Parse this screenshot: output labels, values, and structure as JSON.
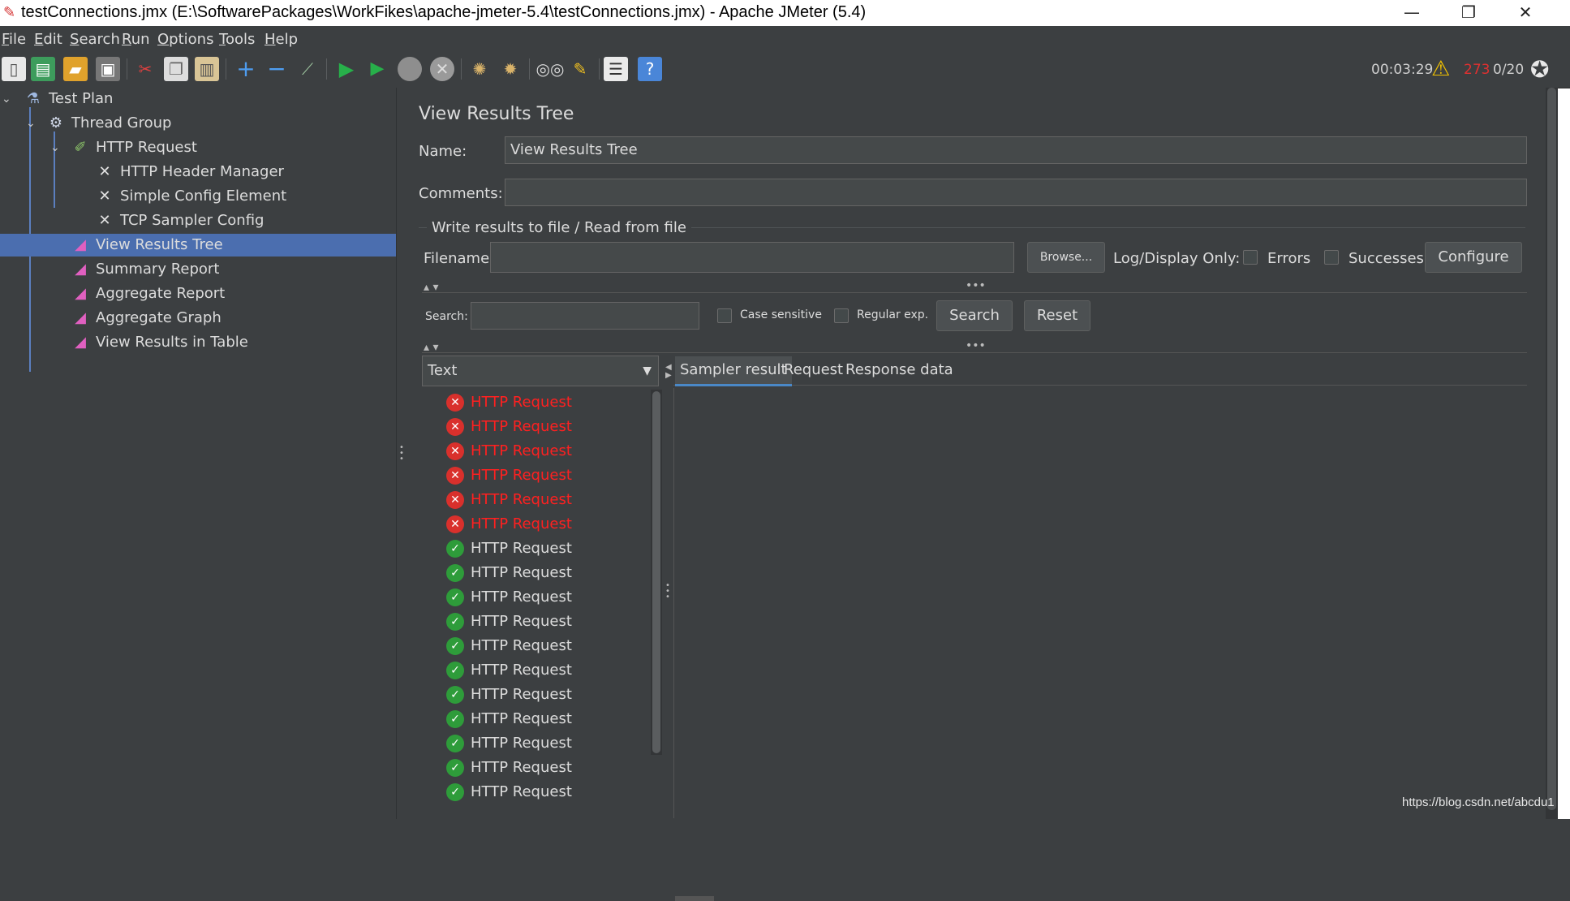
{
  "window": {
    "title": "testConnections.jmx (E:\\SoftwarePackages\\WorkFikes\\apache-jmeter-5.4\\testConnections.jmx) - Apache JMeter (5.4)",
    "minimize_icon": "minimize-icon",
    "restore_icon": "restore-icon",
    "close_icon": "close-icon"
  },
  "menu": [
    "File",
    "Edit",
    "Search",
    "Run",
    "Options",
    "Tools",
    "Help"
  ],
  "toolbar": {
    "icons": [
      "new-icon",
      "templates-icon",
      "open-icon",
      "save-icon",
      "cut-icon",
      "copy-icon",
      "paste-icon",
      "expand-icon",
      "collapse-icon",
      "toggle-icon",
      "start-icon",
      "start-no-pause-icon",
      "stop-icon",
      "shutdown-icon",
      "clear-icon",
      "clear-all-icon",
      "search-icon",
      "reset-search-icon",
      "function-helper-icon",
      "help-icon"
    ],
    "timer": "00:03:29",
    "warnings": "273",
    "threads": "0/20"
  },
  "tree": {
    "items": [
      {
        "label": "Test Plan",
        "icon": "flask-icon"
      },
      {
        "label": "Thread Group",
        "icon": "gear-icon"
      },
      {
        "label": "HTTP Request",
        "icon": "pipette-icon"
      },
      {
        "label": "HTTP Header Manager",
        "icon": "wrench-icon"
      },
      {
        "label": "Simple Config Element",
        "icon": "wrench-icon"
      },
      {
        "label": "TCP Sampler Config",
        "icon": "wrench-icon"
      },
      {
        "label": "View Results Tree",
        "icon": "chart-icon"
      },
      {
        "label": "Summary Report",
        "icon": "chart-icon"
      },
      {
        "label": "Aggregate Report",
        "icon": "chart-icon"
      },
      {
        "label": "Aggregate Graph",
        "icon": "chart-icon"
      },
      {
        "label": "View Results in Table",
        "icon": "chart-icon"
      }
    ]
  },
  "panel": {
    "title": "View Results Tree",
    "name_label": "Name:",
    "name_value": "View Results Tree",
    "comments_label": "Comments:",
    "comments_value": "",
    "file_section": "Write results to file / Read from file",
    "filename_label": "Filename",
    "filename_value": "",
    "browse_label": "Browse...",
    "log_only_label": "Log/Display Only:",
    "errors_label": "Errors",
    "successes_label": "Successes",
    "configure_label": "Configure",
    "search_label": "Search:",
    "search_value": "",
    "case_sensitive_label": "Case sensitive",
    "regex_label": "Regular exp.",
    "search_button": "Search",
    "reset_button": "Reset",
    "renderer_value": "Text",
    "tabs": [
      "Sampler result",
      "Request",
      "Response data"
    ]
  },
  "results": [
    {
      "label": "HTTP Request",
      "status": "fail"
    },
    {
      "label": "HTTP Request",
      "status": "fail"
    },
    {
      "label": "HTTP Request",
      "status": "fail"
    },
    {
      "label": "HTTP Request",
      "status": "fail"
    },
    {
      "label": "HTTP Request",
      "status": "fail"
    },
    {
      "label": "HTTP Request",
      "status": "fail"
    },
    {
      "label": "HTTP Request",
      "status": "ok"
    },
    {
      "label": "HTTP Request",
      "status": "ok"
    },
    {
      "label": "HTTP Request",
      "status": "ok"
    },
    {
      "label": "HTTP Request",
      "status": "ok"
    },
    {
      "label": "HTTP Request",
      "status": "ok"
    },
    {
      "label": "HTTP Request",
      "status": "ok"
    },
    {
      "label": "HTTP Request",
      "status": "ok"
    },
    {
      "label": "HTTP Request",
      "status": "ok"
    },
    {
      "label": "HTTP Request",
      "status": "ok"
    },
    {
      "label": "HTTP Request",
      "status": "ok"
    },
    {
      "label": "HTTP Request",
      "status": "ok"
    }
  ],
  "watermark": "https://blog.csdn.net/abcdu1"
}
